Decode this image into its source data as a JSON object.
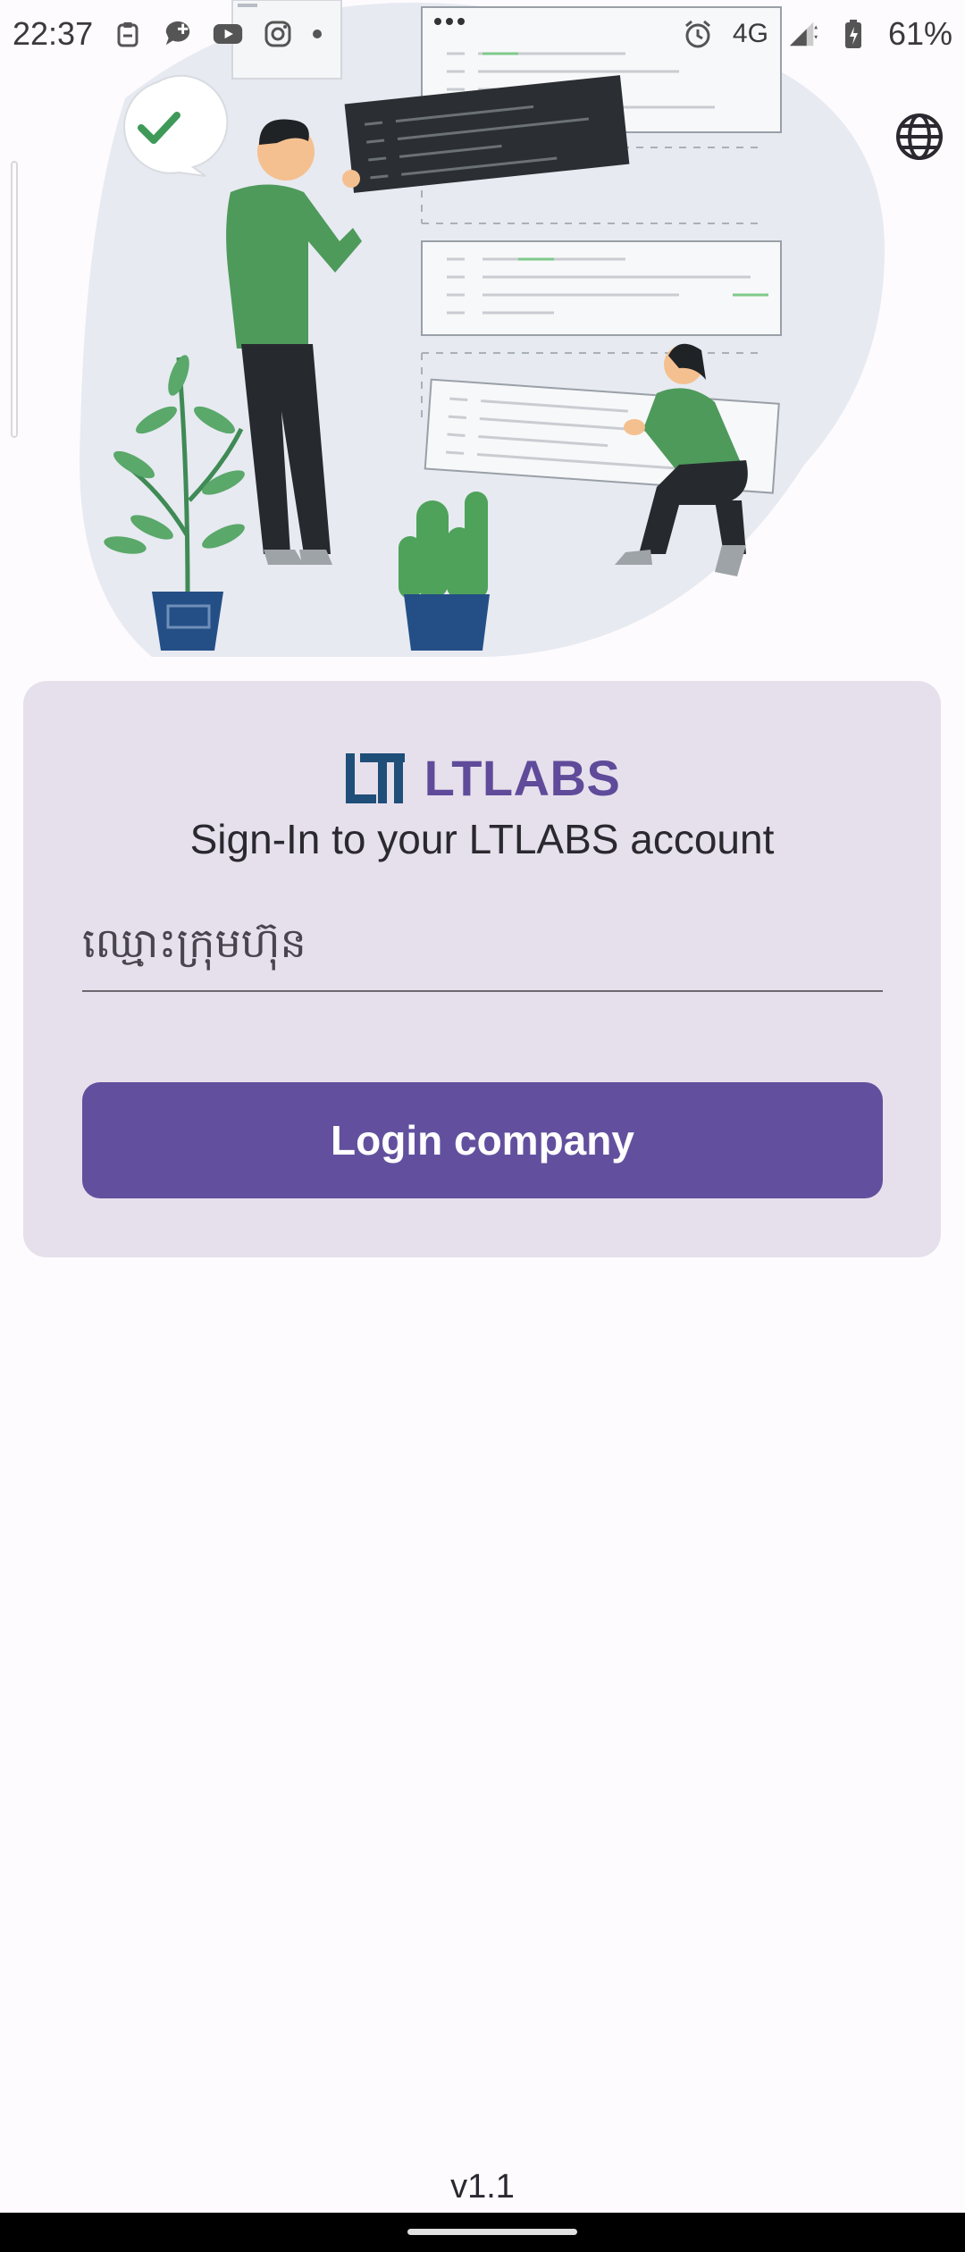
{
  "status_bar": {
    "time": "22:37",
    "network": "4G",
    "battery": "61%",
    "icons_left": [
      "clipboard-icon",
      "chat-plus-icon",
      "youtube-icon",
      "instagram-icon",
      "notification-dot"
    ],
    "icons_right": [
      "alarm-icon",
      "signal-icon",
      "battery-charging-icon"
    ]
  },
  "header": {
    "language_icon": "globe-icon"
  },
  "login_card": {
    "brand_name": "LTLABS",
    "subtitle": "Sign-In to your LTLABS account",
    "company_field": {
      "placeholder": "ឈ្មោះក្រុមហ៊ុន",
      "value": ""
    },
    "login_button_label": "Login company"
  },
  "footer": {
    "version": "v1.1"
  },
  "colors": {
    "primary": "#62509e",
    "brand_text": "#5f4b9a",
    "card_bg": "#e6e0ec",
    "illustration_green": "#4caf50",
    "logo_blue": "#1f4e79"
  }
}
